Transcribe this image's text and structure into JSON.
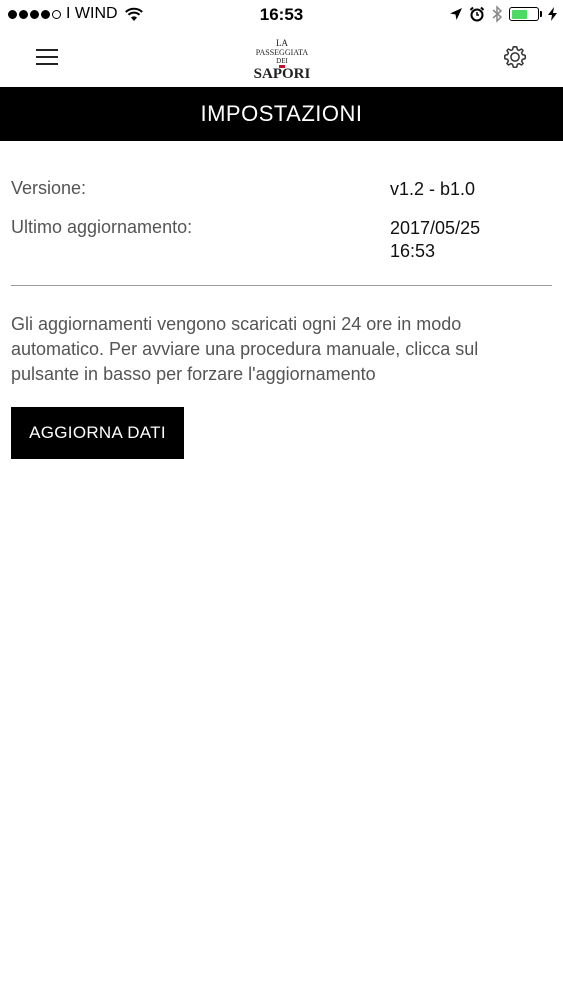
{
  "status_bar": {
    "signal_dots_filled": 4,
    "signal_dots_total": 5,
    "carrier": "I WIND",
    "time": "16:53",
    "battery_level": 0.6,
    "battery_color": "#4cd964",
    "icons": [
      "wifi-icon",
      "location-arrow-icon",
      "alarm-icon",
      "bluetooth-icon",
      "battery-icon",
      "charging-bolt-icon"
    ]
  },
  "nav_bar": {
    "menu_icon": "hamburger-menu-icon",
    "logo": {
      "line1": "LA",
      "line2": "PASSEGGIATA",
      "line3": "DEI",
      "line4": "SAPORI"
    },
    "settings_icon": "gear-icon"
  },
  "title_bar": {
    "title": "IMPOSTAZIONI",
    "background": "#000000"
  },
  "info": {
    "version_label": "Versione:",
    "version_value": "v1.2 - b1.0",
    "last_update_label": "Ultimo aggiornamento:",
    "last_update_date": "2017/05/25",
    "last_update_time": "16:53"
  },
  "description": "Gli aggiornamenti vengono scaricati ogni 24 ore in modo automatico. Per avviare una procedura manuale, clicca sul pulsante in basso per forzare l'aggiornamento",
  "actions": {
    "update_button_label": "AGGIORNA DATI"
  }
}
